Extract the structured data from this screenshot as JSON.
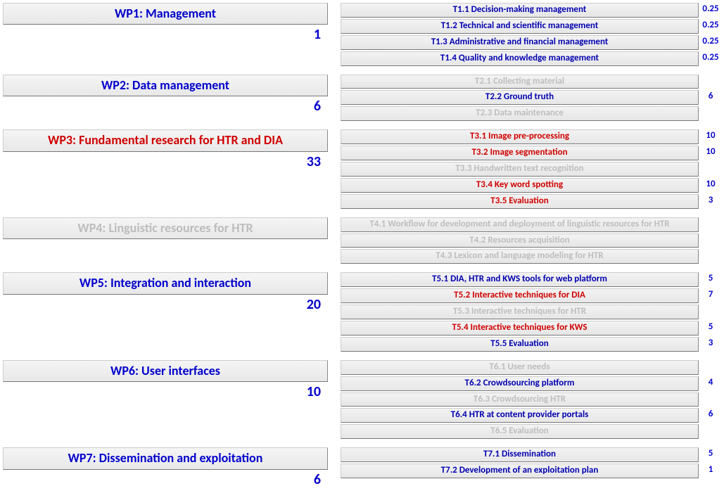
{
  "wps": [
    {
      "title": "WP1: Management",
      "color": "blue",
      "count": "1",
      "tasks": [
        {
          "label": "T1.1 Decision-making management",
          "color": "blue",
          "value": "0.25"
        },
        {
          "label": "T1.2 Technical and scientific management",
          "color": "blue",
          "value": "0.25"
        },
        {
          "label": "T1.3 Administrative and financial management",
          "color": "blue",
          "value": "0.25"
        },
        {
          "label": "T1.4 Quality and knowledge management",
          "color": "blue",
          "value": "0.25"
        }
      ]
    },
    {
      "title": "WP2: Data management",
      "color": "blue",
      "count": "6",
      "tasks": [
        {
          "label": "T2.1 Collecting material",
          "color": "grey",
          "value": ""
        },
        {
          "label": "T2.2 Ground truth",
          "color": "blue",
          "value": "6"
        },
        {
          "label": "T2.3 Data maintenance",
          "color": "grey",
          "value": ""
        }
      ]
    },
    {
      "title": "WP3: Fundamental research for HTR and DIA",
      "color": "red",
      "count": "33",
      "tasks": [
        {
          "label": "T3.1 Image pre-processing",
          "color": "red",
          "value": "10"
        },
        {
          "label": "T3.2 Image segmentation",
          "color": "red",
          "value": "10"
        },
        {
          "label": "T3.3 Handwritten text recognition",
          "color": "grey",
          "value": ""
        },
        {
          "label": "T3.4 Key word spotting",
          "color": "red",
          "value": "10"
        },
        {
          "label": "T3.5 Evaluation",
          "color": "red",
          "value": "3"
        }
      ]
    },
    {
      "title": "WP4: Linguistic resources for HTR",
      "color": "grey",
      "count": "",
      "tasks": [
        {
          "label": "T4.1 Workflow for development and deployment of linguistic resources for HTR",
          "color": "grey",
          "value": ""
        },
        {
          "label": "T4.2 Resources acquisition",
          "color": "grey",
          "value": ""
        },
        {
          "label": "T4.3 Lexicon and language modeling for HTR",
          "color": "grey",
          "value": ""
        }
      ]
    },
    {
      "title": "WP5: Integration and interaction",
      "color": "blue",
      "count": "20",
      "tasks": [
        {
          "label": "T5.1 DIA, HTR and KWS tools for web platform",
          "color": "blue",
          "value": "5"
        },
        {
          "label": "T5.2 Interactive techniques for DIA",
          "color": "red",
          "value": "7"
        },
        {
          "label": "T5.3 Interactive techniques for HTR",
          "color": "grey",
          "value": ""
        },
        {
          "label": "T5.4 Interactive techniques for KWS",
          "color": "red",
          "value": "5"
        },
        {
          "label": "T5.5 Evaluation",
          "color": "blue",
          "value": "3"
        }
      ]
    },
    {
      "title": "WP6: User interfaces",
      "color": "blue",
      "count": "10",
      "tasks": [
        {
          "label": "T6.1 User needs",
          "color": "grey",
          "value": ""
        },
        {
          "label": "T6.2 Crowdsourcing platform",
          "color": "blue",
          "value": "4"
        },
        {
          "label": "T6.3 Crowdsourcing HTR",
          "color": "grey",
          "value": ""
        },
        {
          "label": "T6.4 HTR at content provider portals",
          "color": "blue",
          "value": "6"
        },
        {
          "label": "T6.5 Evaluation",
          "color": "grey",
          "value": ""
        }
      ]
    },
    {
      "title": "WP7: Dissemination and exploitation",
      "color": "blue",
      "count": "6",
      "tasks": [
        {
          "label": "T7.1 Dissemination",
          "color": "blue",
          "value": "5"
        },
        {
          "label": "T7.2 Development of an exploitation plan",
          "color": "blue",
          "value": "1"
        }
      ]
    }
  ]
}
